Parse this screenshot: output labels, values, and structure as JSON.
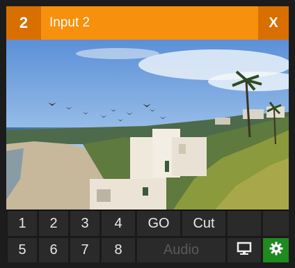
{
  "header": {
    "input_number": "2",
    "title": "Input 2",
    "close_label": "X"
  },
  "buttons": {
    "row1": [
      "1",
      "2",
      "3",
      "4"
    ],
    "go": "GO",
    "cut": "Cut",
    "row2": [
      "5",
      "6",
      "7",
      "8"
    ],
    "audio": "Audio"
  },
  "icons": {
    "monitor": "monitor-icon",
    "settings": "gear-icon"
  },
  "colors": {
    "titlebar": "#f7900c",
    "titlebar_accent": "#d86f00",
    "settings_bg": "#1f8a1f"
  }
}
